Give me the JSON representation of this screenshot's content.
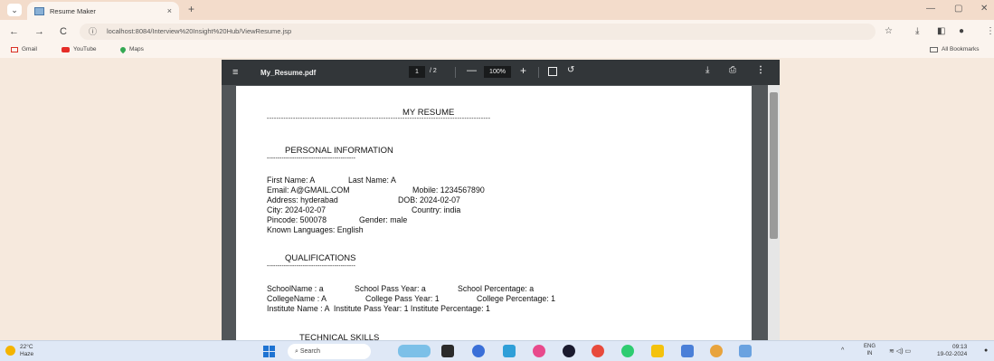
{
  "browser": {
    "tab_title": "Resume Maker",
    "tab_close": "×",
    "new_tab": "+",
    "tab_menu": "⌄",
    "url": "localhost:8084/Interview%20Insight%20Hub/ViewResume.jsp",
    "back": "←",
    "forward": "→",
    "reload": "C",
    "win_min": "—",
    "win_restore": "▢",
    "win_close": "✕",
    "bookmarks": [
      {
        "label": "Gmail",
        "icon": "gmail-icon"
      },
      {
        "label": "YouTube",
        "icon": "youtube-icon"
      },
      {
        "label": "Maps",
        "icon": "maps-icon"
      }
    ],
    "all_bookmarks": "All Bookmarks"
  },
  "pdf_viewer": {
    "filename": "My_Resume.pdf",
    "current_page": "1",
    "total_pages": "/ 2",
    "zoom": "100%",
    "menu_icon": "≡",
    "minus": "—",
    "plus": "+",
    "download_icon": "⤓",
    "print_icon": "⎙",
    "more_icon": "⋮",
    "rotate_icon": "↺"
  },
  "resume": {
    "title": "MY RESUME",
    "title_rule": "----------------------------------------------------------------------------------------------",
    "personal_heading": "PERSONAL INFORMATION",
    "personal_rule": "------------------------------------------",
    "first_name": "First Name: A",
    "last_name": "Last Name: A",
    "email": "Email: A@GMAIL.COM",
    "mobile": "Mobile: 1234567890",
    "address": "Address: hyderabad",
    "dob": "DOB: 2024-02-07",
    "city": "City: 2024-02-07",
    "country": "Country: india",
    "pincode": "Pincode: 500078",
    "gender": "Gender: male",
    "languages": "Known Languages: English",
    "qual_heading": "QUALIFICATIONS",
    "qual_rule": "------------------------------------------",
    "school_name": "SchoolName : a",
    "school_pass": "School Pass Year: a",
    "school_pct": "School Percentage: a",
    "college_name": "CollegeName : A",
    "college_pass": "College Pass Year: 1",
    "college_pct": "College Percentage: 1",
    "institute_line": "Institute Name : A  Institute Pass Year: 1 Institute Percentage: 1",
    "tech_heading": "TECHNICAL SKILLS"
  },
  "taskbar": {
    "temp": "22°C",
    "condition": "Haze",
    "search_placeholder": "Search",
    "lang": "ENG",
    "region": "IN",
    "time": "09:13",
    "date": "19-02-2024",
    "tray_arrow": "^",
    "wifi_sound_battery": "≋ ◁) ▭"
  }
}
